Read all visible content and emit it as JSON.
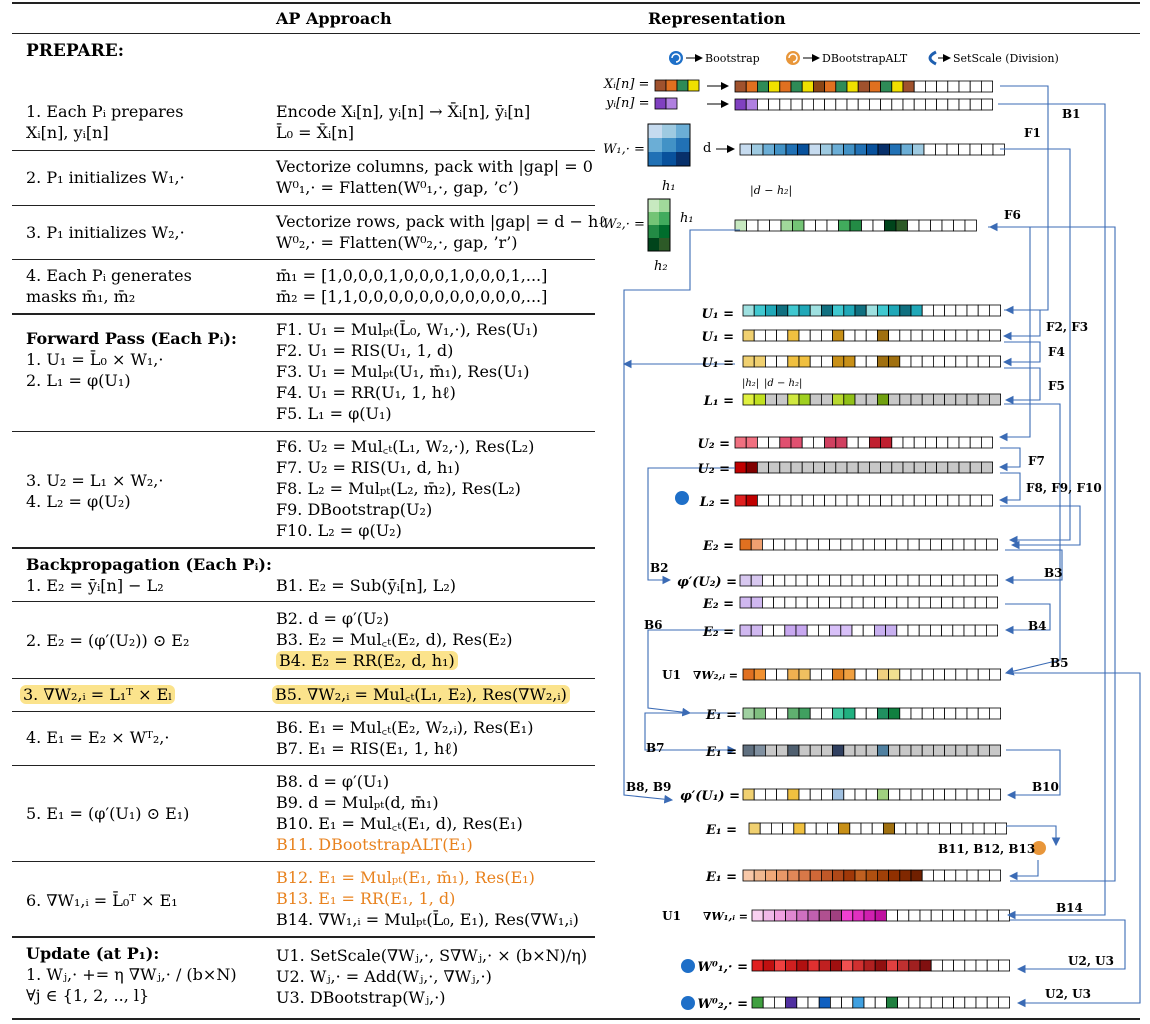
{
  "headers": {
    "approach": "AP Approach",
    "representation": "Representation"
  },
  "prepare_title": "PREPARE:",
  "rows": [
    {
      "left": [
        "1. Each Pᵢ prepares",
        "Xᵢ[n], yᵢ[n]"
      ],
      "mid": [
        "Encode Xᵢ[n], yᵢ[n] → X̄ᵢ[n], ȳᵢ[n]",
        "L̄₀ = X̄ᵢ[n]"
      ]
    },
    {
      "left": [
        "2. P₁ initializes W₁,·"
      ],
      "mid": [
        "Vectorize columns, pack with |gap| = 0",
        "W⁰₁,· = Flatten(W⁰₁,·, gap, ’c’)"
      ]
    },
    {
      "left": [
        "3. P₁ initializes W₂,·"
      ],
      "mid": [
        "Vectorize rows, pack with |gap| = d − hℓ",
        "W⁰₂,· = Flatten(W⁰₂,·, gap, ’r’)"
      ]
    },
    {
      "left": [
        "4. Each Pᵢ generates",
        "masks m̄₁, m̄₂"
      ],
      "mid": [
        "m̄₁ = [1,0,0,0,1,0,0,0,1,0,0,0,1,...]",
        "m̄₂ = [1,1,0,0,0,0,0,0,0,0,0,0,0,...]"
      ]
    },
    {
      "left": [
        "Forward Pass (Each Pᵢ):",
        "",
        "1. U₁ = L̄₀ × W₁,·",
        "2. L₁ = φ(U₁)"
      ],
      "mid": [
        "F1. U₁ = Mulₚₜ(L̄₀, W₁,·), Res(U₁)",
        "F2. U₁ = RIS(U₁, 1, d)",
        "F3. U₁ = Mulₚₜ(U₁, m̄₁), Res(U₁)",
        "F4. U₁ = RR(U₁, 1, hℓ)",
        "F5. L₁ = φ(U₁)"
      ]
    },
    {
      "left": [
        "3. U₂ = L₁ × W₂,·",
        "4. L₂ = φ(U₂)"
      ],
      "mid": [
        "F6. U₂ = Mul꜀ₜ(L₁, W₂,·), Res(L₂)",
        "F7. U₂ = RIS(U₁, d, h₁)",
        "F8. L₂ = Mulₚₜ(L₂, m̄₂), Res(L₂)",
        "F9. DBootstrap(U₂)",
        "F10. L₂ = φ(U₂)"
      ]
    },
    {
      "left": [
        "Backpropagation (Each Pᵢ):",
        "1. E₂ = ȳᵢ[n] − L₂"
      ],
      "mid": [
        "B1. E₂ = Sub(ȳᵢ[n], L₂)"
      ]
    },
    {
      "left": [
        "2. E₂ = (φ′(U₂)) ⊙ E₂"
      ],
      "mid": [
        "B2. d = φ′(U₂)",
        "B3. E₂ = Mul꜀ₜ(E₂, d), Res(E₂)",
        "B4. E₂ = RR(E₂, d, h₁)"
      ]
    },
    {
      "left": [
        "3. ∇W₂,ᵢ = L₁ᵀ × Eₗ"
      ],
      "mid": [
        "B5. ∇W₂,ᵢ = Mul꜀ₜ(L₁, E₂), Res(∇W₂,ᵢ)"
      ]
    },
    {
      "left": [
        "4. E₁ = E₂ × Wᵀ₂,·"
      ],
      "mid": [
        "B6. E₁ = Mul꜀ₜ(E₂, W₂,ᵢ), Res(E₁)",
        "B7. E₁ = RIS(E₁, 1, hℓ)"
      ]
    },
    {
      "left": [
        "5. E₁ = (φ′(U₁) ⊙ E₁)"
      ],
      "mid": [
        "B8. d = φ′(U₁)",
        "B9. d = Mulₚₜ(d, m̄₁)",
        "B10. E₁ = Mul꜀ₜ(E₁, d), Res(E₁)",
        "B11. DBootstrapALT(E₁)"
      ]
    },
    {
      "left": [
        "6. ∇W₁,ᵢ = L̄₀ᵀ × E₁"
      ],
      "mid": [
        "B12. E₁ = Mulₚₜ(E₁, m̄₁), Res(E₁)",
        "B13. E₁ = RR(E₁, 1, d)",
        "B14. ∇W₁,ᵢ = Mulₚₜ(L̄₀, E₁), Res(∇W₁,ᵢ)"
      ]
    },
    {
      "left": [
        "Update (at P₁):",
        "1. Wⱼ,· += η ∇Wⱼ,· / (b×N)",
        "∀j ∈ {1, 2, .., l}"
      ],
      "mid": [
        "U1. SetScale(∇Wⱼ,·, S∇Wⱼ,· × (b×N)/η)",
        "U2. Wⱼ,· = Add(Wⱼ,·, ∇Wⱼ,·)",
        "U3. DBootstrap(Wⱼ,·)"
      ]
    }
  ],
  "legend": {
    "bootstrap": "Bootstrap",
    "dbootstrap_alt": "DBootstrapALT",
    "setscale": "SetScale (Division)"
  },
  "rep_labels": {
    "xi": "Xᵢ[n] =",
    "yi": "yᵢ[n] =",
    "w1": "W₁,· =",
    "w2": "W₂,· =",
    "d": "d",
    "h1": "h₁",
    "h2": "h₂",
    "dh2": "|d − h₂|",
    "u1": "U₁ =",
    "l1": "L₁ =",
    "u2": "U₂ =",
    "l2": "L₂ =",
    "e2": "E₂ =",
    "phi_u2": "φ′(U₂) =",
    "grad_w2": "∇W₂,ᵢ =",
    "e1": "E₁ =",
    "phi_u1": "φ′(U₁) =",
    "grad_w1": "∇W₁,ᵢ =",
    "w1_0": "W⁰₁,· =",
    "w2_0": "W⁰₂,· =",
    "u1_prefix": "U1",
    "h2_small": "|h₂|",
    "dh2_small": "|d − h₂|"
  },
  "step_labels": [
    "B1",
    "F1",
    "F6",
    "F2, F3",
    "F4",
    "F5",
    "F7",
    "F8, F9, F10",
    "B2",
    "B3",
    "B4",
    "B6",
    "B5",
    "B7",
    "B8, B9",
    "B10",
    "B11, B12, B13",
    "B14",
    "U2, U3",
    "U2, U3"
  ],
  "colors": {
    "arrow": "#3b6bb5",
    "highlight": "#fbe38c",
    "orange": "#e8821e"
  }
}
